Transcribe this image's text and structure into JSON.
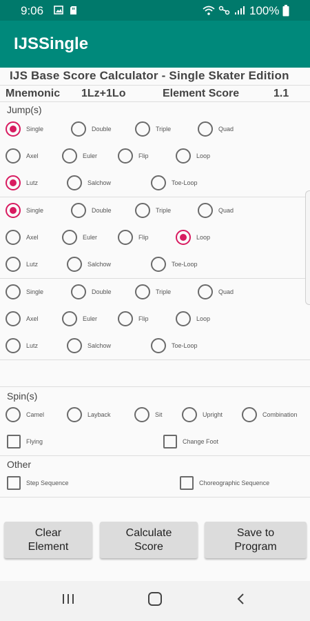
{
  "status_bar": {
    "time": "9:06",
    "battery": "100%"
  },
  "app": {
    "title": "IJSSingle"
  },
  "calculator": {
    "title": "IJS Base Score Calculator - Single Skater Edition",
    "mnemonic_label": "Mnemonic",
    "mnemonic_value": "1Lz+1Lo",
    "score_label": "Element Score",
    "score_value": "1.1"
  },
  "jumps": {
    "section_label": "Jump(s)",
    "labels": {
      "single": "Single",
      "double": "Double",
      "triple": "Triple",
      "quad": "Quad",
      "axel": "Axel",
      "euler": "Euler",
      "flip": "Flip",
      "loop": "Loop",
      "lutz": "Lutz",
      "salchow": "Salchow",
      "toe_loop": "Toe-Loop"
    },
    "groups": [
      {
        "rotation": "Single",
        "type": "Lutz"
      },
      {
        "rotation": "Single",
        "type": "Loop"
      },
      {
        "rotation": "",
        "type": ""
      }
    ]
  },
  "spins": {
    "section_label": "Spin(s)",
    "options": [
      "Camel",
      "Layback",
      "Sit",
      "Upright",
      "Combination"
    ],
    "flying_label": "Flying",
    "change_foot_label": "Change Foot"
  },
  "other": {
    "section_label": "Other",
    "step_sequence_label": "Step Sequence",
    "choreo_sequence_label": "Choreographic Sequence"
  },
  "buttons": {
    "clear": "Clear\nElement",
    "calculate": "Calculate\nScore",
    "save": "Save to\nProgram"
  },
  "colors": {
    "primary": "#00897b",
    "primary_dark": "#00796b",
    "accent": "#d81b60"
  }
}
